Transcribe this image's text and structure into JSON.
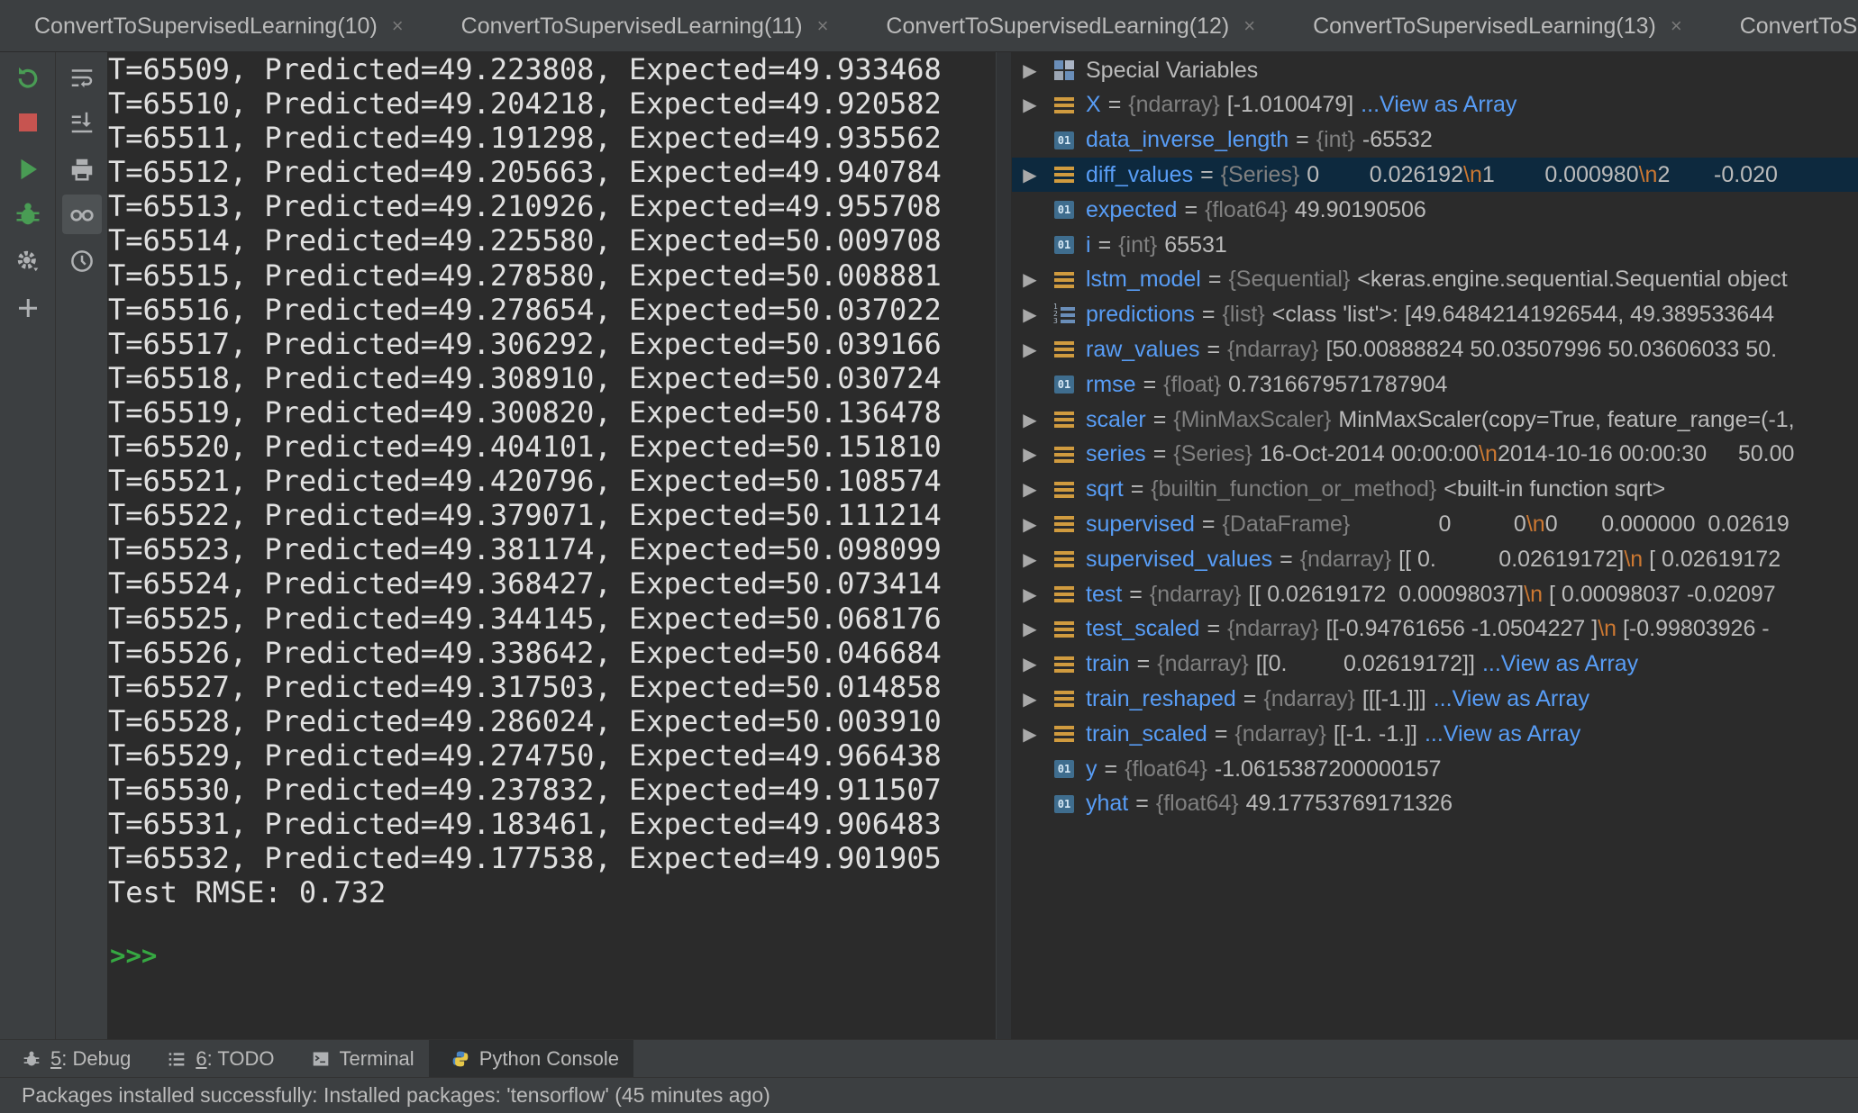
{
  "tabs": [
    {
      "label": "ConvertToSupervisedLearning(10)"
    },
    {
      "label": "ConvertToSupervisedLearning(11)"
    },
    {
      "label": "ConvertToSupervisedLearning(12)"
    },
    {
      "label": "ConvertToSupervisedLearning(13)"
    },
    {
      "label": "ConvertToS"
    }
  ],
  "tab_close_glyph": "×",
  "console": {
    "lines": [
      "T=65509, Predicted=49.223808, Expected=49.933468",
      "T=65510, Predicted=49.204218, Expected=49.920582",
      "T=65511, Predicted=49.191298, Expected=49.935562",
      "T=65512, Predicted=49.205663, Expected=49.940784",
      "T=65513, Predicted=49.210926, Expected=49.955708",
      "T=65514, Predicted=49.225580, Expected=50.009708",
      "T=65515, Predicted=49.278580, Expected=50.008881",
      "T=65516, Predicted=49.278654, Expected=50.037022",
      "T=65517, Predicted=49.306292, Expected=50.039166",
      "T=65518, Predicted=49.308910, Expected=50.030724",
      "T=65519, Predicted=49.300820, Expected=50.136478",
      "T=65520, Predicted=49.404101, Expected=50.151810",
      "T=65521, Predicted=49.420796, Expected=50.108574",
      "T=65522, Predicted=49.379071, Expected=50.111214",
      "T=65523, Predicted=49.381174, Expected=50.098099",
      "T=65524, Predicted=49.368427, Expected=50.073414",
      "T=65525, Predicted=49.344145, Expected=50.068176",
      "T=65526, Predicted=49.338642, Expected=50.046684",
      "T=65527, Predicted=49.317503, Expected=50.014858",
      "T=65528, Predicted=49.286024, Expected=50.003910",
      "T=65529, Predicted=49.274750, Expected=49.966438",
      "T=65530, Predicted=49.237832, Expected=49.911507",
      "T=65531, Predicted=49.183461, Expected=49.906483",
      "T=65532, Predicted=49.177538, Expected=49.901905",
      "Test RMSE: 0.732"
    ],
    "prompt": ">>>"
  },
  "variables": [
    {
      "expandable": true,
      "icon": "grid",
      "name": "Special Variables",
      "plain": true,
      "type": "",
      "value": "",
      "link": ""
    },
    {
      "expandable": true,
      "icon": "list",
      "name": "X",
      "type": "{ndarray}",
      "value": "[-1.0100479]",
      "link": "...View as Array"
    },
    {
      "expandable": false,
      "icon": "01",
      "name": "data_inverse_length",
      "type": "{int}",
      "value": "-65532",
      "link": ""
    },
    {
      "expandable": true,
      "icon": "list",
      "name": "diff_values",
      "type": "{Series}",
      "value_parts": [
        "0        0.026192",
        "\\n",
        "1        0.000980",
        "\\n",
        "2       -0.020"
      ],
      "link": "",
      "selected": true
    },
    {
      "expandable": false,
      "icon": "01",
      "name": "expected",
      "type": "{float64}",
      "value": "49.90190506",
      "link": ""
    },
    {
      "expandable": false,
      "icon": "01",
      "name": "i",
      "type": "{int}",
      "value": "65531",
      "link": ""
    },
    {
      "expandable": true,
      "icon": "list",
      "name": "lstm_model",
      "type": "{Sequential}",
      "value": "<keras.engine.sequential.Sequential object",
      "link": ""
    },
    {
      "expandable": true,
      "icon": "num",
      "name": "predictions",
      "type": "{list}",
      "value": "<class 'list'>: [49.64842141926544, 49.389533644",
      "link": ""
    },
    {
      "expandable": true,
      "icon": "list",
      "name": "raw_values",
      "type": "{ndarray}",
      "value": "[50.00888824 50.03507996 50.03606033 50.",
      "link": ""
    },
    {
      "expandable": false,
      "icon": "01",
      "name": "rmse",
      "type": "{float}",
      "value": "0.7316679571787904",
      "link": ""
    },
    {
      "expandable": true,
      "icon": "list",
      "name": "scaler",
      "type": "{MinMaxScaler}",
      "value": "MinMaxScaler(copy=True, feature_range=(-1,",
      "link": ""
    },
    {
      "expandable": true,
      "icon": "list",
      "name": "series",
      "type": "{Series}",
      "value_parts": [
        "16-Oct-2014 00:00:00",
        "\\n",
        "2014-10-16 00:00:30     50.00"
      ],
      "link": ""
    },
    {
      "expandable": true,
      "icon": "list",
      "name": "sqrt",
      "type": "{builtin_function_or_method}",
      "value": "<built-in function sqrt>",
      "link": ""
    },
    {
      "expandable": true,
      "icon": "list",
      "name": "supervised",
      "type": "{DataFrame}",
      "value_parts": [
        "             0          0",
        "\\n",
        "0       0.000000  0.02619"
      ],
      "link": ""
    },
    {
      "expandable": true,
      "icon": "list",
      "name": "supervised_values",
      "type": "{ndarray}",
      "value_parts": [
        "[[ 0.          0.02619172]",
        "\\n",
        " [ 0.02619172"
      ],
      "link": ""
    },
    {
      "expandable": true,
      "icon": "list",
      "name": "test",
      "type": "{ndarray}",
      "value_parts": [
        "[[ 0.02619172  0.00098037]",
        "\\n",
        " [ 0.00098037 -0.02097"
      ],
      "link": ""
    },
    {
      "expandable": true,
      "icon": "list",
      "name": "test_scaled",
      "type": "{ndarray}",
      "value_parts": [
        "[[-0.94761656 -1.0504227 ]",
        "\\n",
        " [-0.99803926 -"
      ],
      "link": ""
    },
    {
      "expandable": true,
      "icon": "list",
      "name": "train",
      "type": "{ndarray}",
      "value": "[[0.         0.02619172]]",
      "link": "...View as Array"
    },
    {
      "expandable": true,
      "icon": "list",
      "name": "train_reshaped",
      "type": "{ndarray}",
      "value": "[[[-1.]]]",
      "link": "...View as Array"
    },
    {
      "expandable": true,
      "icon": "list",
      "name": "train_scaled",
      "type": "{ndarray}",
      "value": "[[-1. -1.]]",
      "link": "...View as Array"
    },
    {
      "expandable": false,
      "icon": "01",
      "name": "y",
      "type": "{float64}",
      "value": "-1.0615387200000157",
      "link": ""
    },
    {
      "expandable": false,
      "icon": "01",
      "name": "yhat",
      "type": "{float64}",
      "value": "49.17753769171326",
      "link": ""
    }
  ],
  "bottom_tabs": [
    {
      "key": "5",
      "label": ": Debug",
      "icon": "bug-icon"
    },
    {
      "key": "6",
      "label": ": TODO",
      "icon": "todo-icon"
    },
    {
      "key": "",
      "label": "Terminal",
      "icon": "terminal-icon"
    },
    {
      "key": "",
      "label": "Python Console",
      "icon": "python-icon",
      "active": true
    }
  ],
  "status": {
    "message": "Packages installed successfully: Installed packages: 'tensorflow' (45 minutes ago)"
  },
  "colors": {
    "background": "#2b2b2b",
    "panel": "#3c3f41",
    "link": "#589df6",
    "selection": "#0d293e",
    "prompt": "#36a842",
    "stop": "#c75450",
    "run": "#499c54"
  },
  "toolbar_icons": [
    "rerun-icon",
    "stop-icon",
    "run-icon",
    "debug-icon",
    "settings-icon",
    "add-icon"
  ],
  "toolbar2_icons": [
    "soft-wrap-icon",
    "scroll-to-end-icon",
    "print-icon",
    "show-variables-icon",
    "history-icon"
  ]
}
